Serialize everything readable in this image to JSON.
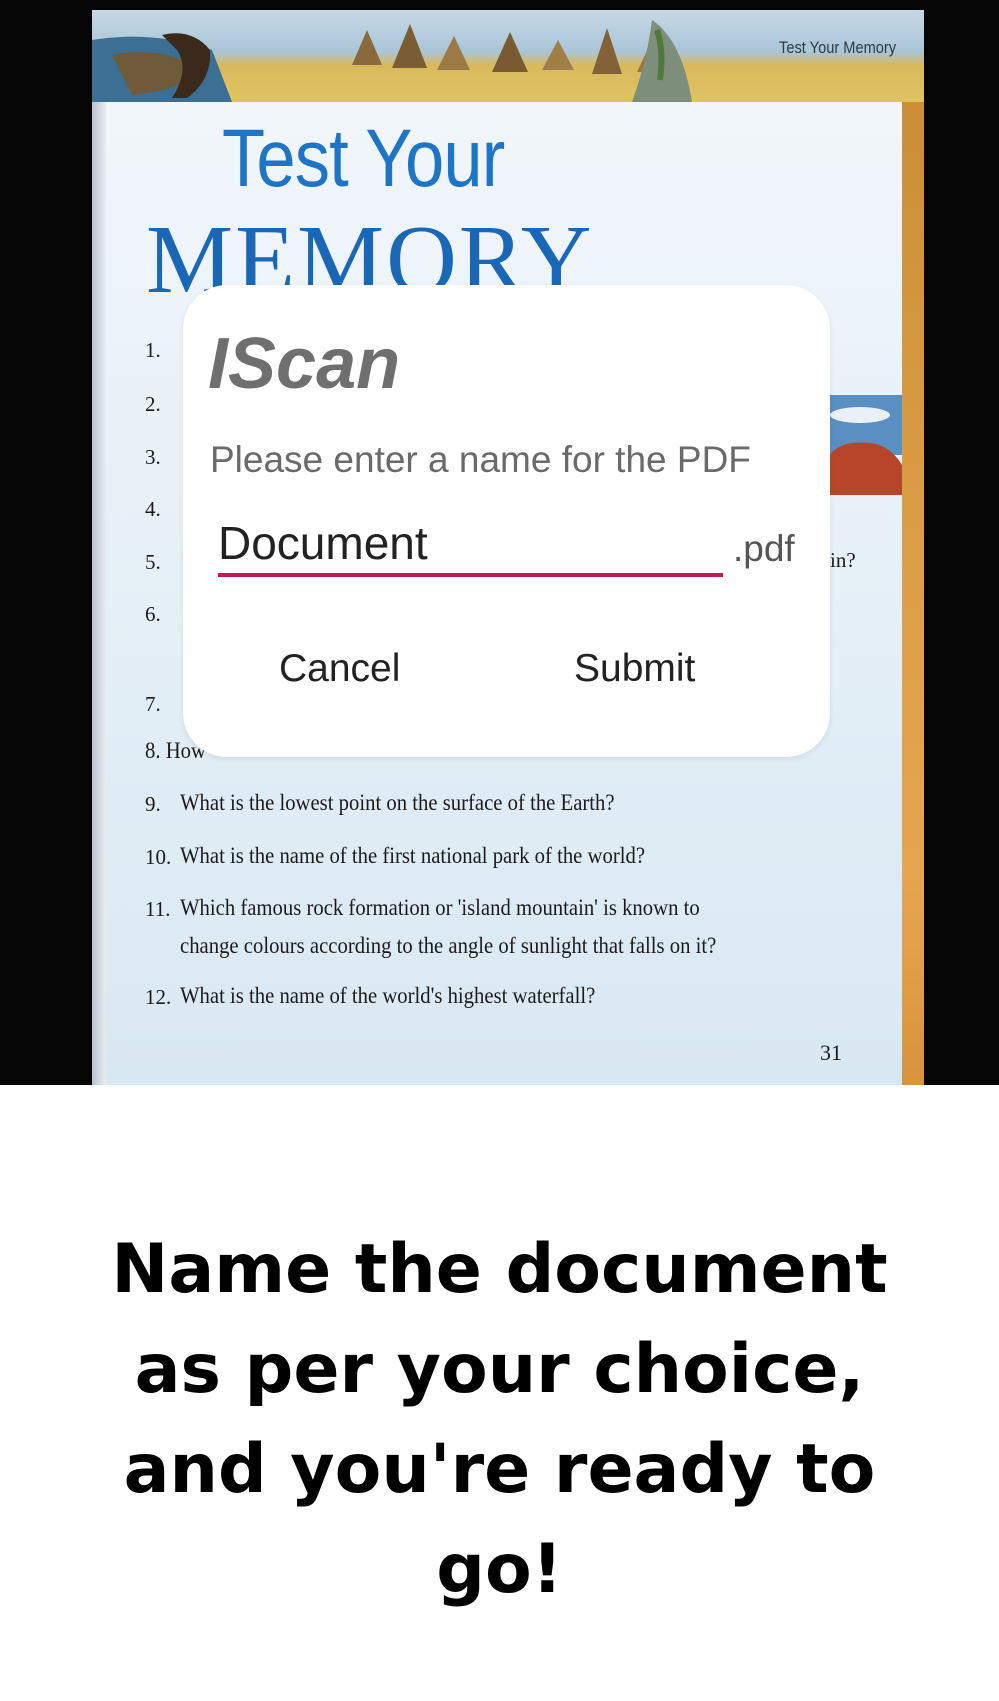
{
  "book_page": {
    "running_head": "Test Your Memory",
    "title_line1": "Test Your",
    "title_line2": "MEMORY",
    "numbers_left": [
      "1.",
      "2.",
      "3.",
      "4.",
      "5.",
      "6.",
      "7."
    ],
    "fragment_q5": "in?",
    "q8_partial": "8. How",
    "questions": [
      {
        "num": "9.",
        "text": "What is the lowest point on the surface of the Earth?"
      },
      {
        "num": "10.",
        "text": "What is the name of the first national park of the world?"
      },
      {
        "num": "11.",
        "text": "Which famous rock formation or 'island mountain' is known to"
      },
      {
        "num": "",
        "text": "change colours according to the angle of sunlight that falls on it?"
      },
      {
        "num": "12.",
        "text": "What is the name of the world's highest waterfall?"
      }
    ],
    "page_number": "31"
  },
  "dialog": {
    "title": "IScan",
    "message": "Please enter a name for the PDF",
    "filename_value": "Document",
    "suffix": ".pdf",
    "cancel_label": "Cancel",
    "submit_label": "Submit",
    "accent_color": "#c2185b"
  },
  "caption": {
    "lines": [
      "Name the document",
      "as per your choice,",
      "and you're ready to",
      "go!"
    ]
  }
}
